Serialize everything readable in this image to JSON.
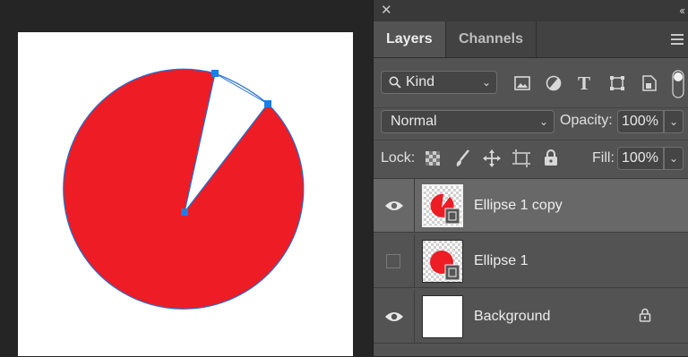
{
  "canvas": {
    "document_bg": "#ffffff",
    "shape_fill": "#ee1c25",
    "path_stroke": "#1f6fd6",
    "anchor_color": "#1a7fe8"
  },
  "panel": {
    "close_icon": "close-icon",
    "collapse_icon": "double-chevron-icon",
    "tabs": [
      {
        "label": "Layers",
        "active": true
      },
      {
        "label": "Channels",
        "active": false
      }
    ],
    "menu_icon": "hamburger-menu-icon"
  },
  "filter": {
    "kind_label": "Kind",
    "icons": [
      "image-filter-icon",
      "adjustment-filter-icon",
      "type-filter-icon",
      "shape-filter-icon",
      "smart-object-filter-icon",
      "filter-toggle-icon"
    ]
  },
  "blend": {
    "mode": "Normal",
    "opacity_label": "Opacity:",
    "opacity_value": "100%"
  },
  "lock": {
    "label": "Lock:",
    "icons": [
      "lock-transparent-pixels-icon",
      "lock-image-pixels-icon",
      "lock-position-icon",
      "lock-artboard-icon",
      "lock-all-icon"
    ],
    "fill_label": "Fill:",
    "fill_value": "100%"
  },
  "layers": [
    {
      "name": "Ellipse 1 copy",
      "visible": true,
      "selected": true,
      "type": "shape"
    },
    {
      "name": "Ellipse 1",
      "visible": false,
      "selected": false,
      "type": "shape"
    },
    {
      "name": "Background",
      "visible": true,
      "selected": false,
      "type": "background",
      "locked": true
    }
  ]
}
